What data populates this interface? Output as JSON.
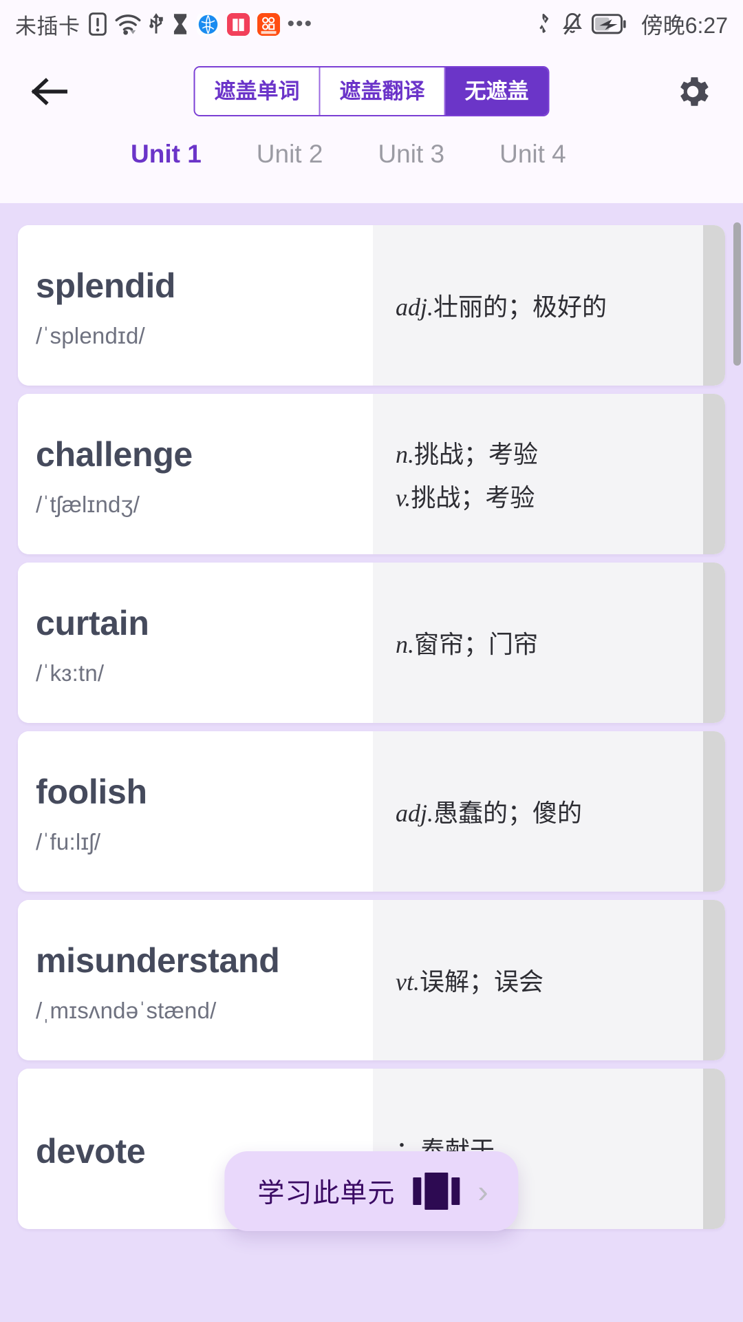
{
  "status_bar": {
    "carrier": "未插卡",
    "time": "傍晚6:27",
    "icons": [
      "sim-alert-icon",
      "wifi-icon",
      "usb-icon",
      "hourglass-icon",
      "browser-app-icon",
      "book-app-icon",
      "video-app-icon",
      "more-dots-icon",
      "bluetooth-off-icon",
      "notifications-muted-icon",
      "battery-charging-icon"
    ]
  },
  "header": {
    "back_label": "←",
    "settings_label": "gear",
    "mask_modes": [
      {
        "label": "遮盖单词",
        "active": false
      },
      {
        "label": "遮盖翻译",
        "active": false
      },
      {
        "label": "无遮盖",
        "active": true
      }
    ],
    "tabs": [
      {
        "label": "Unit 1",
        "active": true
      },
      {
        "label": "Unit 2",
        "active": false
      },
      {
        "label": "Unit 3",
        "active": false
      },
      {
        "label": "Unit 4",
        "active": false
      }
    ]
  },
  "words": [
    {
      "word": "splendid",
      "phonetic": "/ˈsplendɪd/",
      "definitions": [
        {
          "pos": "adj.",
          "meaning": "壮丽的；极好的"
        }
      ]
    },
    {
      "word": "challenge",
      "phonetic": "/ˈtʃælɪndʒ/",
      "definitions": [
        {
          "pos": "n.",
          "meaning": "挑战；考验"
        },
        {
          "pos": "v.",
          "meaning": "挑战；考验"
        }
      ]
    },
    {
      "word": "curtain",
      "phonetic": "/ˈkɜ:tn/",
      "definitions": [
        {
          "pos": "n.",
          "meaning": "窗帘；门帘"
        }
      ]
    },
    {
      "word": "foolish",
      "phonetic": "/ˈfu:lɪʃ/",
      "definitions": [
        {
          "pos": "adj.",
          "meaning": "愚蠢的；傻的"
        }
      ]
    },
    {
      "word": "misunderstand",
      "phonetic": "/ˌmɪsʌndəˈstænd/",
      "definitions": [
        {
          "pos": "vt.",
          "meaning": "误解；误会"
        }
      ]
    },
    {
      "word": "devote",
      "phonetic": "",
      "definitions": [
        {
          "pos": "",
          "meaning": "；奉献于"
        }
      ]
    }
  ],
  "fab": {
    "label": "学习此单元",
    "icon": "card-stack-icon",
    "chevron": "›"
  },
  "colors": {
    "accent": "#6b35c8",
    "header_bg": "#fdf9ff",
    "list_bg": "#e8dcfa",
    "page_bg": "#e4dde9",
    "card_bg": "#ffffff",
    "card_def_bg": "#f4f4f6",
    "fab_bg": "#e9d8fb",
    "fab_text": "#3a0a63",
    "word_text": "#454a5c"
  }
}
